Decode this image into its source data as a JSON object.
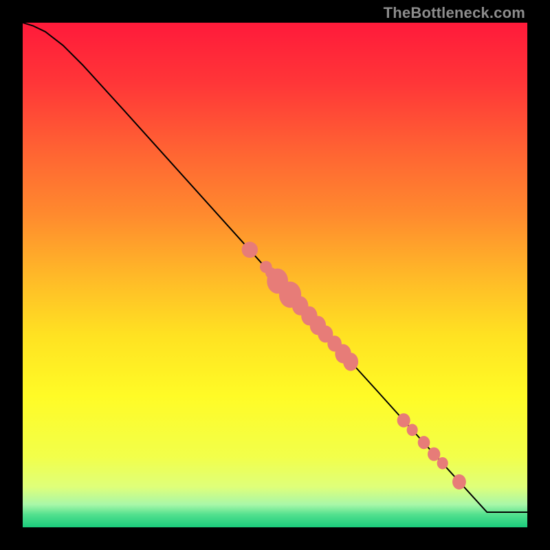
{
  "watermark": "TheBottleneck.com",
  "chart_data": {
    "type": "line",
    "title": "",
    "xlabel": "",
    "ylabel": "",
    "xlim": [
      0,
      100
    ],
    "ylim": [
      0,
      100
    ],
    "grid": false,
    "background_gradient": {
      "stops": [
        {
          "offset": 0.0,
          "color": "#ff1a3a"
        },
        {
          "offset": 0.12,
          "color": "#ff3638"
        },
        {
          "offset": 0.25,
          "color": "#ff6233"
        },
        {
          "offset": 0.38,
          "color": "#ff8a2e"
        },
        {
          "offset": 0.5,
          "color": "#ffb828"
        },
        {
          "offset": 0.62,
          "color": "#ffe222"
        },
        {
          "offset": 0.74,
          "color": "#fffb26"
        },
        {
          "offset": 0.86,
          "color": "#f2ff4a"
        },
        {
          "offset": 0.92,
          "color": "#dfff7a"
        },
        {
          "offset": 0.955,
          "color": "#a8f7a8"
        },
        {
          "offset": 0.975,
          "color": "#52e08e"
        },
        {
          "offset": 1.0,
          "color": "#1acb7c"
        }
      ]
    },
    "series": [
      {
        "name": "curve",
        "stroke": "#000000",
        "stroke_width": 2,
        "x": [
          0.0,
          2.0,
          4.5,
          8.0,
          12.0,
          20.0,
          30.0,
          40.0,
          50.0,
          60.0,
          70.0,
          80.0,
          88.0,
          92.0,
          100.0
        ],
        "y": [
          100.0,
          99.4,
          98.2,
          95.5,
          91.5,
          82.7,
          71.6,
          60.5,
          49.4,
          38.3,
          27.3,
          16.2,
          7.4,
          3.0,
          3.0
        ]
      }
    ],
    "markers": {
      "color": "#e77c78",
      "stroke": "#00000000",
      "points": [
        {
          "x": 45.0,
          "y": 55.0,
          "rx": 1.6,
          "ry": 1.6
        },
        {
          "x": 48.2,
          "y": 51.6,
          "rx": 1.2,
          "ry": 1.2
        },
        {
          "x": 49.2,
          "y": 50.4,
          "rx": 1.1,
          "ry": 1.1
        },
        {
          "x": 50.5,
          "y": 48.8,
          "rx": 2.1,
          "ry": 2.5
        },
        {
          "x": 53.0,
          "y": 46.1,
          "rx": 2.2,
          "ry": 2.6
        },
        {
          "x": 55.0,
          "y": 43.9,
          "rx": 1.6,
          "ry": 1.9
        },
        {
          "x": 56.8,
          "y": 41.9,
          "rx": 1.6,
          "ry": 1.9
        },
        {
          "x": 58.5,
          "y": 40.0,
          "rx": 1.6,
          "ry": 1.9
        },
        {
          "x": 60.0,
          "y": 38.3,
          "rx": 1.5,
          "ry": 1.7
        },
        {
          "x": 61.8,
          "y": 36.4,
          "rx": 1.4,
          "ry": 1.6
        },
        {
          "x": 63.5,
          "y": 34.4,
          "rx": 1.6,
          "ry": 1.9
        },
        {
          "x": 65.0,
          "y": 32.8,
          "rx": 1.5,
          "ry": 1.8
        },
        {
          "x": 75.5,
          "y": 21.2,
          "rx": 1.3,
          "ry": 1.4
        },
        {
          "x": 77.2,
          "y": 19.3,
          "rx": 1.1,
          "ry": 1.2
        },
        {
          "x": 79.5,
          "y": 16.8,
          "rx": 1.2,
          "ry": 1.3
        },
        {
          "x": 81.5,
          "y": 14.5,
          "rx": 1.25,
          "ry": 1.35
        },
        {
          "x": 83.2,
          "y": 12.7,
          "rx": 1.1,
          "ry": 1.2
        },
        {
          "x": 86.5,
          "y": 9.0,
          "rx": 1.35,
          "ry": 1.5
        }
      ]
    }
  }
}
